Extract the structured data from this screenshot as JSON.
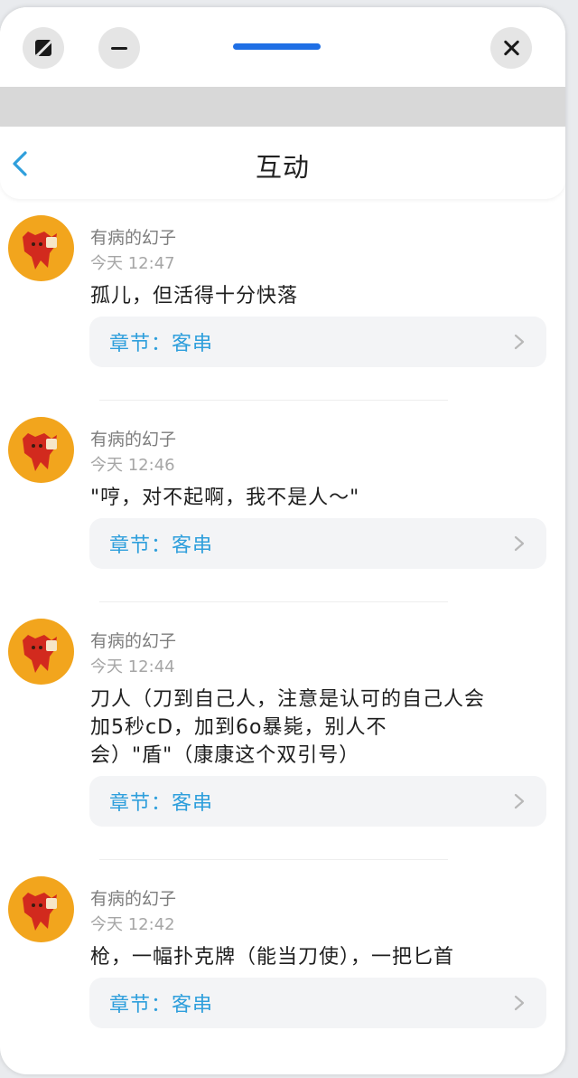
{
  "header": {
    "title": "互动"
  },
  "icons": {
    "mode": "split-screen-icon",
    "minimize": "minimize-icon",
    "close": "close-icon",
    "back": "chevron-left-icon",
    "chapter_arrow": "chevron-right-icon"
  },
  "colors": {
    "accent": "#2f9fdc",
    "drag_handle": "#1f6fe5",
    "avatar_bg": "#f2a51d"
  },
  "comments": [
    {
      "user": "有病的幻子",
      "time": "今天 12:47",
      "text": "孤儿，但活得十分快落",
      "chapter": "章节：客串"
    },
    {
      "user": "有病的幻子",
      "time": "今天 12:46",
      "text": "\"哼，对不起啊，我不是人～\"",
      "chapter": "章节：客串"
    },
    {
      "user": "有病的幻子",
      "time": "今天 12:44",
      "text": "刀人（刀到自己人，注意是认可的自己人会加5秒cD，加到6o暴毙，别人不会）\"盾\"（康康这个双引号）",
      "chapter": "章节：客串"
    },
    {
      "user": "有病的幻子",
      "time": "今天 12:42",
      "text": "枪，一幅扑克牌（能当刀使），一把匕首",
      "chapter": "章节：客串"
    }
  ]
}
